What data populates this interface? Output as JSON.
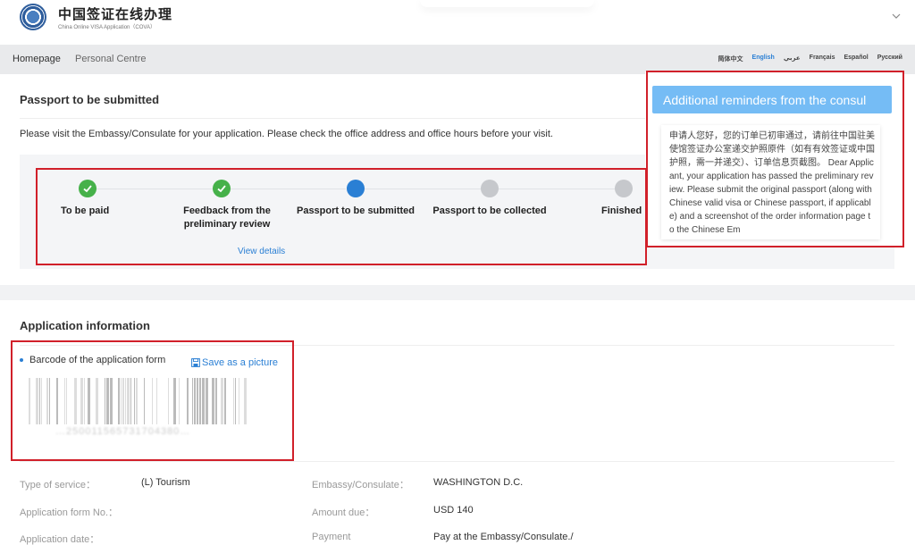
{
  "header": {
    "logo_icon": "emblem-seal-icon",
    "title": "中国签证在线办理",
    "subtitle": "China Online VISA Application（COVA）",
    "menu_icon": "chevron-down-icon"
  },
  "nav": {
    "home": "Homepage",
    "personal": "Personal Centre",
    "languages": [
      "简体中文",
      "English",
      "عربي",
      "Français",
      "Español",
      "Русский"
    ],
    "active_language": "English"
  },
  "status_card": {
    "title": "Passport to be submitted",
    "note": "Please visit the Embassy/Consulate for your application. Please check the office address and office hours before your visit.",
    "steps": [
      {
        "label": "To be paid",
        "state": "done"
      },
      {
        "label": "Feedback from the preliminary review",
        "state": "done"
      },
      {
        "label": "Passport to be submitted",
        "state": "current"
      },
      {
        "label": "Passport to be collected",
        "state": "pending"
      },
      {
        "label": "Finished",
        "state": "pending"
      }
    ],
    "view_details": "View details"
  },
  "reminder": {
    "button_label": "Additional reminders from the consul",
    "text": "申请人您好，您的订单已初审通过，请前往中国驻美使馆签证办公室递交护照原件（如有有效签证或中国护照，需一并递交）、订单信息页截图。 Dear Applicant, your application has passed the preliminary review. Please submit the original passport (along with Chinese valid visa or Chinese passport, if applicable) and a screenshot of the order information page to the Chinese Em"
  },
  "application": {
    "title": "Application information",
    "barcode_label": "Barcode of the application form",
    "save_label": "Save as a picture",
    "save_icon": "save-icon",
    "barcode_number": "…250011565731704380…",
    "fields_left": [
      {
        "key": "Type of service：",
        "value": "(L) Tourism"
      },
      {
        "key": "Application form No.：",
        "value": ""
      },
      {
        "key": "Application date：",
        "value": ""
      }
    ],
    "fields_right": [
      {
        "key": "Embassy/Consulate：",
        "value": "WASHINGTON D.C."
      },
      {
        "key": "Amount due：",
        "value": "USD 140"
      },
      {
        "key": "Payment",
        "value": "Pay at the Embassy/Consulate./"
      }
    ]
  },
  "colors": {
    "accent": "#2a7fd4",
    "done": "#46b14a",
    "pending": "#c6c8cc",
    "highlight": "#d1202a",
    "reminder_button": "#75bcf5"
  }
}
